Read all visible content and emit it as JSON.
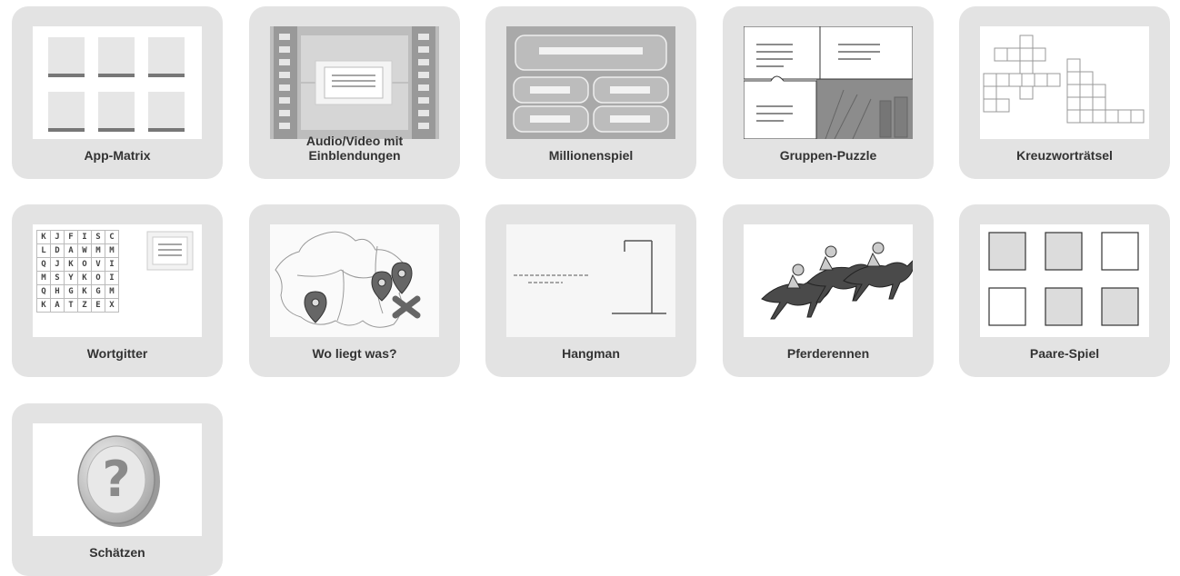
{
  "tiles": [
    {
      "label": "App-Matrix",
      "icon": "app-matrix-thumbnail"
    },
    {
      "label": "Audio/Video mit\nEinblendungen",
      "icon": "video-film-thumbnail"
    },
    {
      "label": "Millionenspiel",
      "icon": "quiz-thumbnail"
    },
    {
      "label": "Gruppen-Puzzle",
      "icon": "puzzle-thumbnail"
    },
    {
      "label": "Kreuzworträtsel",
      "icon": "crossword-thumbnail"
    },
    {
      "label": "Wortgitter",
      "icon": "word-grid-thumbnail"
    },
    {
      "label": "Wo liegt was?",
      "icon": "map-pin-thumbnail"
    },
    {
      "label": "Hangman",
      "icon": "hangman-thumbnail"
    },
    {
      "label": "Pferderennen",
      "icon": "horse-race-thumbnail"
    },
    {
      "label": "Paare-Spiel",
      "icon": "pairs-thumbnail"
    },
    {
      "label": "Schätzen",
      "icon": "question-mark-thumbnail"
    }
  ],
  "wordgrid": [
    [
      "K",
      "J",
      "F",
      "I",
      "S",
      "C"
    ],
    [
      "L",
      "D",
      "A",
      "W",
      "M",
      "M"
    ],
    [
      "Q",
      "J",
      "K",
      "O",
      "V",
      "I"
    ],
    [
      "M",
      "S",
      "Y",
      "K",
      "O",
      "I"
    ],
    [
      "Q",
      "H",
      "G",
      "K",
      "G",
      "M"
    ],
    [
      "K",
      "A",
      "T",
      "Z",
      "E",
      "X"
    ]
  ],
  "schaetzen_symbol": "?",
  "colors": {
    "tile_bg": "#e3e3e3",
    "label": "#333333"
  }
}
